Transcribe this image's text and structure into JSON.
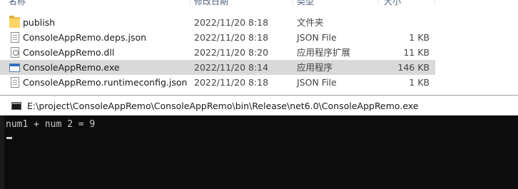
{
  "explorer": {
    "columns": {
      "name": "名称",
      "date": "修改日期",
      "type": "类型",
      "size": "大小"
    },
    "files": [
      {
        "icon": "folder-icon",
        "name": "publish",
        "date": "2022/11/20 8:18",
        "type": "文件夹",
        "size": ""
      },
      {
        "icon": "json-file-icon",
        "name": "ConsoleAppRemo.deps.json",
        "date": "2022/11/20 8:18",
        "type": "JSON File",
        "size": "1 KB"
      },
      {
        "icon": "dll-file-icon",
        "name": "ConsoleAppRemo.dll",
        "date": "2022/11/20 8:20",
        "type": "应用程序扩展",
        "size": "11 KB"
      },
      {
        "icon": "exe-file-icon",
        "name": "ConsoleAppRemo.exe",
        "date": "2022/11/20 8:14",
        "type": "应用程序",
        "size": "146 KB",
        "selected": true
      },
      {
        "icon": "json-file-icon",
        "name": "ConsoleAppRemo.runtimeconfig.json",
        "date": "2022/11/20 8:18",
        "type": "JSON File",
        "size": "1 KB"
      }
    ]
  },
  "console": {
    "title": "E:\\project\\ConsoleAppRemo\\ConsoleAppRemo\\bin\\Release\\net6.0\\ConsoleAppRemo.exe",
    "output": "num1 + num 2 = 9",
    "icon": "console-app-icon"
  },
  "colors": {
    "selection": "#d9d9d9",
    "terminal_bg": "#0c0c0c",
    "terminal_fg": "#cccccc"
  }
}
